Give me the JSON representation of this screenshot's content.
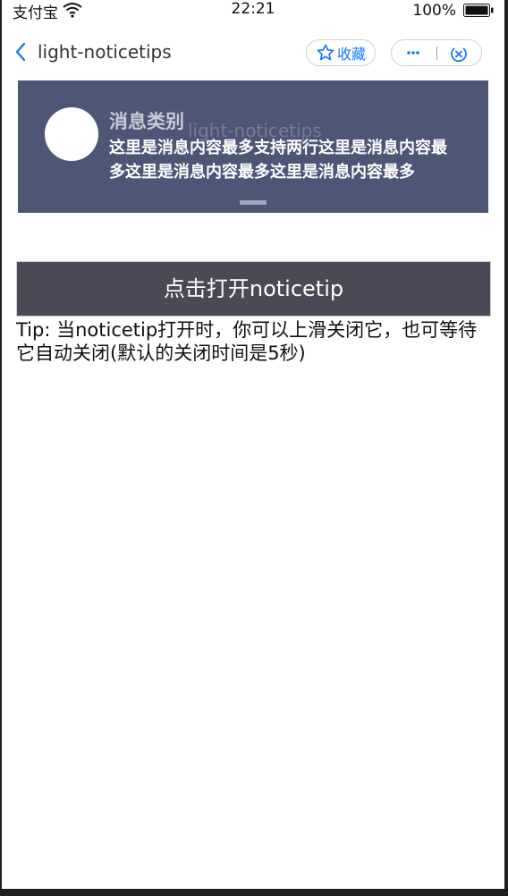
{
  "status_bar": {
    "carrier": "支付宝",
    "time": "22:21",
    "battery": "100%"
  },
  "nav": {
    "title": "light-noticetips",
    "favorite_label": "收藏",
    "accent_color": "#1677ff"
  },
  "noticetip": {
    "ghost_title": "light-noticetips",
    "category": "消息类别",
    "content": "这里是消息内容最多支持两行这里是消息内容最多这里是消息内容最多这里是消息内容最多",
    "background_color": "#4d5675"
  },
  "main": {
    "open_button_label": "点击打开noticetip",
    "tip": "Tip: 当noticetip打开时，你可以上滑关闭它，也可等待它自动关闭(默认的关闭时间是5秒)"
  },
  "icons": [
    "wifi-icon",
    "battery-icon",
    "back-icon",
    "star-icon",
    "more-icon",
    "close-mini-icon"
  ]
}
